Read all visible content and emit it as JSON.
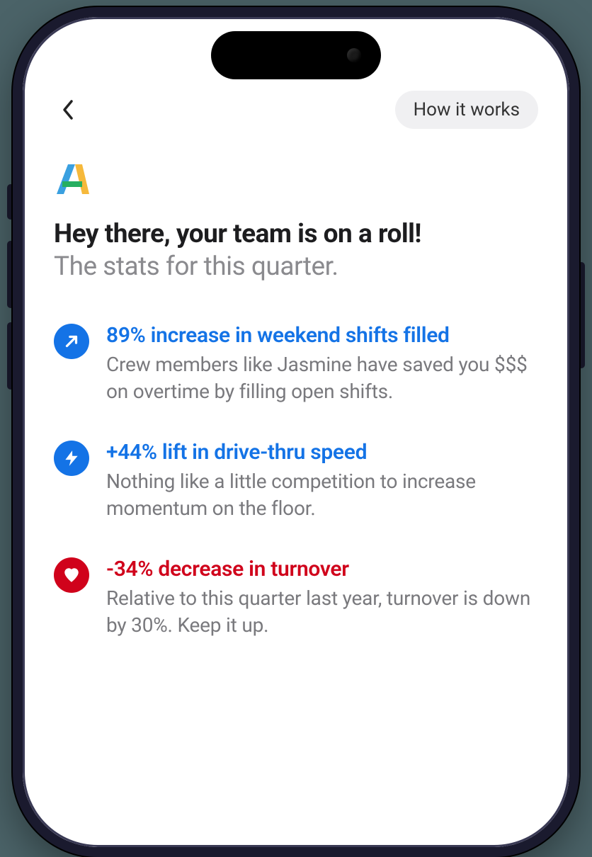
{
  "topbar": {
    "how_it_works": "How it works"
  },
  "header": {
    "title": "Hey there, your team is on a roll!",
    "subtitle": "The stats for this quarter."
  },
  "stats": [
    {
      "icon": "arrow-up-right-icon",
      "badge_color": "blue",
      "title_color": "blue",
      "title": "89% increase in weekend shifts filled",
      "desc": "Crew members like Jasmine have saved you $$$ on overtime by filling open shifts."
    },
    {
      "icon": "bolt-icon",
      "badge_color": "blue",
      "title_color": "blue",
      "title": "+44% lift in drive-thru speed",
      "desc": "Nothing like a little competition to increase momentum on the floor."
    },
    {
      "icon": "heart-icon",
      "badge_color": "red",
      "title_color": "red",
      "title": "-34% decrease in turnover",
      "desc": "Relative to this quarter last year, turnover is down by 30%. Keep it up."
    }
  ]
}
